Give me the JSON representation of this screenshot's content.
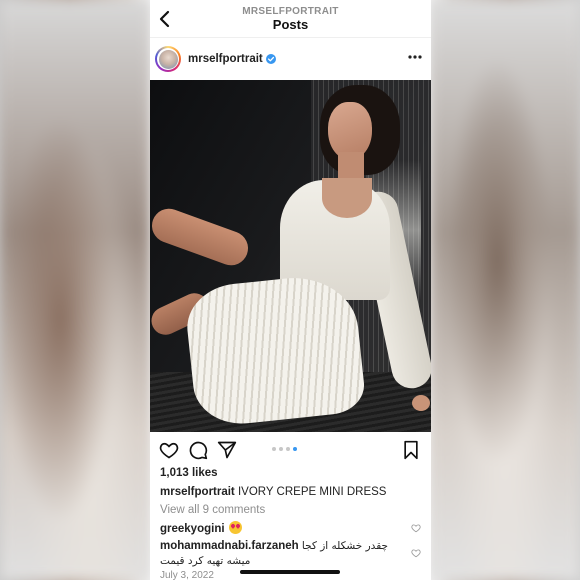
{
  "header": {
    "account_caps": "MRSELFPORTRAIT",
    "title": "Posts"
  },
  "post": {
    "username": "mrselfportrait",
    "likes": "1,013 likes",
    "caption_user": "mrselfportrait",
    "caption_text": "IVORY CREPE MINI DRESS",
    "view_comments": "View all 9 comments",
    "carousel": {
      "total": 4,
      "active_index": 3
    },
    "date": "July 3, 2022"
  },
  "comments": [
    {
      "user": "greekyogini",
      "text": ""
    },
    {
      "user": "mohammadnabi.farzaneh",
      "text_line1": "چقدر خشکله از کجا",
      "text_line2": "میشه تهیه کرد قیمت"
    }
  ],
  "icons": {
    "back": "chevron-left-icon",
    "verified": "verified-badge-icon",
    "more": "more-options-icon",
    "like": "heart-icon",
    "comment": "comment-icon",
    "share": "share-icon",
    "save": "bookmark-icon"
  },
  "colors": {
    "verified_blue": "#3897f0",
    "carousel_active": "#3897f0",
    "muted_text": "#8e8e8e"
  }
}
